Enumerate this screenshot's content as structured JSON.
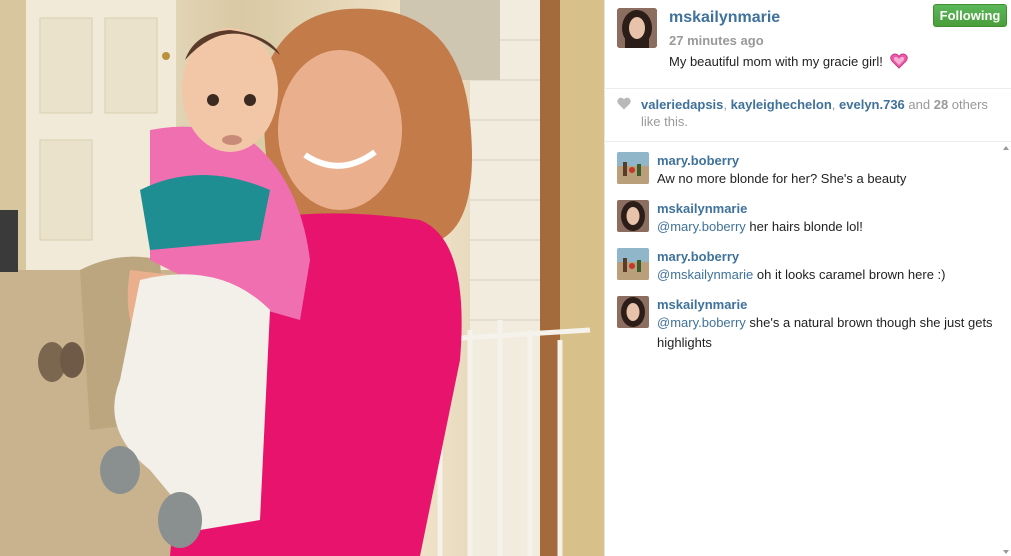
{
  "post": {
    "owner": "mskailynmarie",
    "time_ago": "27 minutes ago",
    "caption": "My beautiful mom with my gracie girl!",
    "follow_label": "Following"
  },
  "likes": {
    "users": [
      "valeriedapsis",
      "kayleighechelon",
      "evelyn.736"
    ],
    "sep1": ", ",
    "sep2": ", ",
    "and_text": " and ",
    "other_count": "28",
    "others_text": " others like this."
  },
  "comments": [
    {
      "user": "mary.boberry",
      "mention": "",
      "text": "Aw no more blonde for her? She's a beauty",
      "avatar": "landscape"
    },
    {
      "user": "mskailynmarie",
      "mention": "@mary.boberry",
      "text": " her hairs blonde lol!",
      "avatar": "portrait"
    },
    {
      "user": "mary.boberry",
      "mention": "@mskailynmarie",
      "text": " oh it looks caramel brown here :)",
      "avatar": "landscape"
    },
    {
      "user": "mskailynmarie",
      "mention": "@mary.boberry",
      "text": " she's a natural brown though she just gets highlights",
      "avatar": "portrait"
    }
  ],
  "colors": {
    "username": "#3f729b",
    "follow_bg": "#4a9e3a",
    "caption_heart": "#e84a9a",
    "muted": "#999999"
  },
  "icons": [
    "heart-emoji-icon",
    "like-heart-icon",
    "scroll-up-icon",
    "scroll-down-icon"
  ]
}
